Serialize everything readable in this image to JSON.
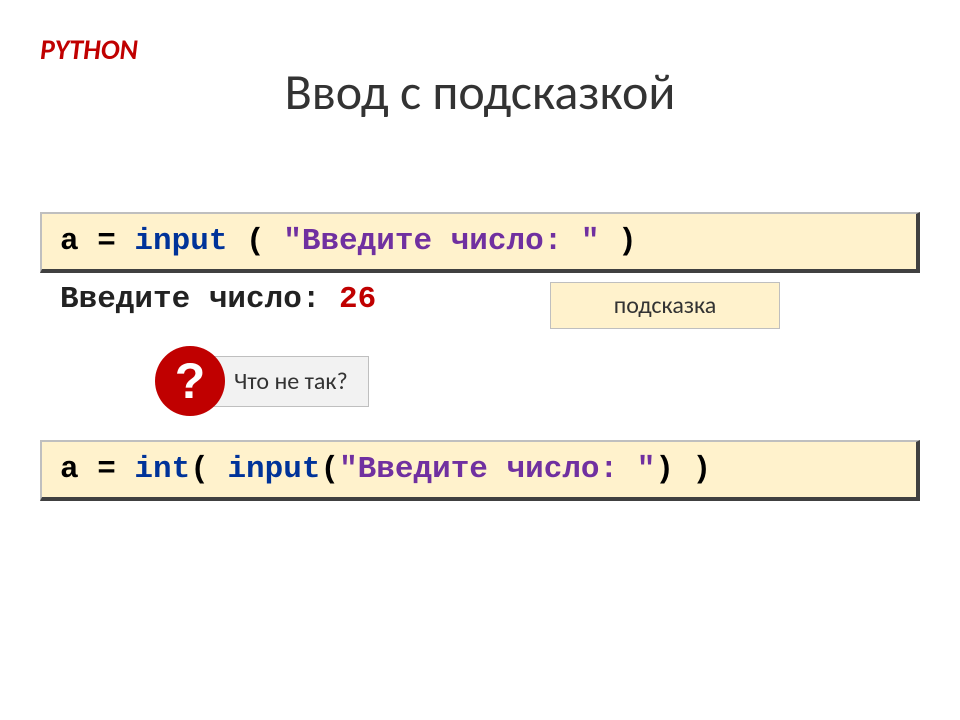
{
  "header": {
    "python_label": "PYTHON",
    "title": "Ввод с подсказкой"
  },
  "code1": {
    "part1": "a = ",
    "part2": "input",
    "part3": " ( ",
    "part4": "\"Введите число: \"",
    "part5": " )"
  },
  "output": {
    "prompt": "Введите число: ",
    "value": "26"
  },
  "hint": {
    "label": "подсказка"
  },
  "question": {
    "mark": "?",
    "text": "Что не так?"
  },
  "code2": {
    "part1": "a = ",
    "part2": "int",
    "part3": "( ",
    "part4": "input",
    "part5": "(",
    "part6": "\"Введите число: \"",
    "part7": ") )"
  }
}
